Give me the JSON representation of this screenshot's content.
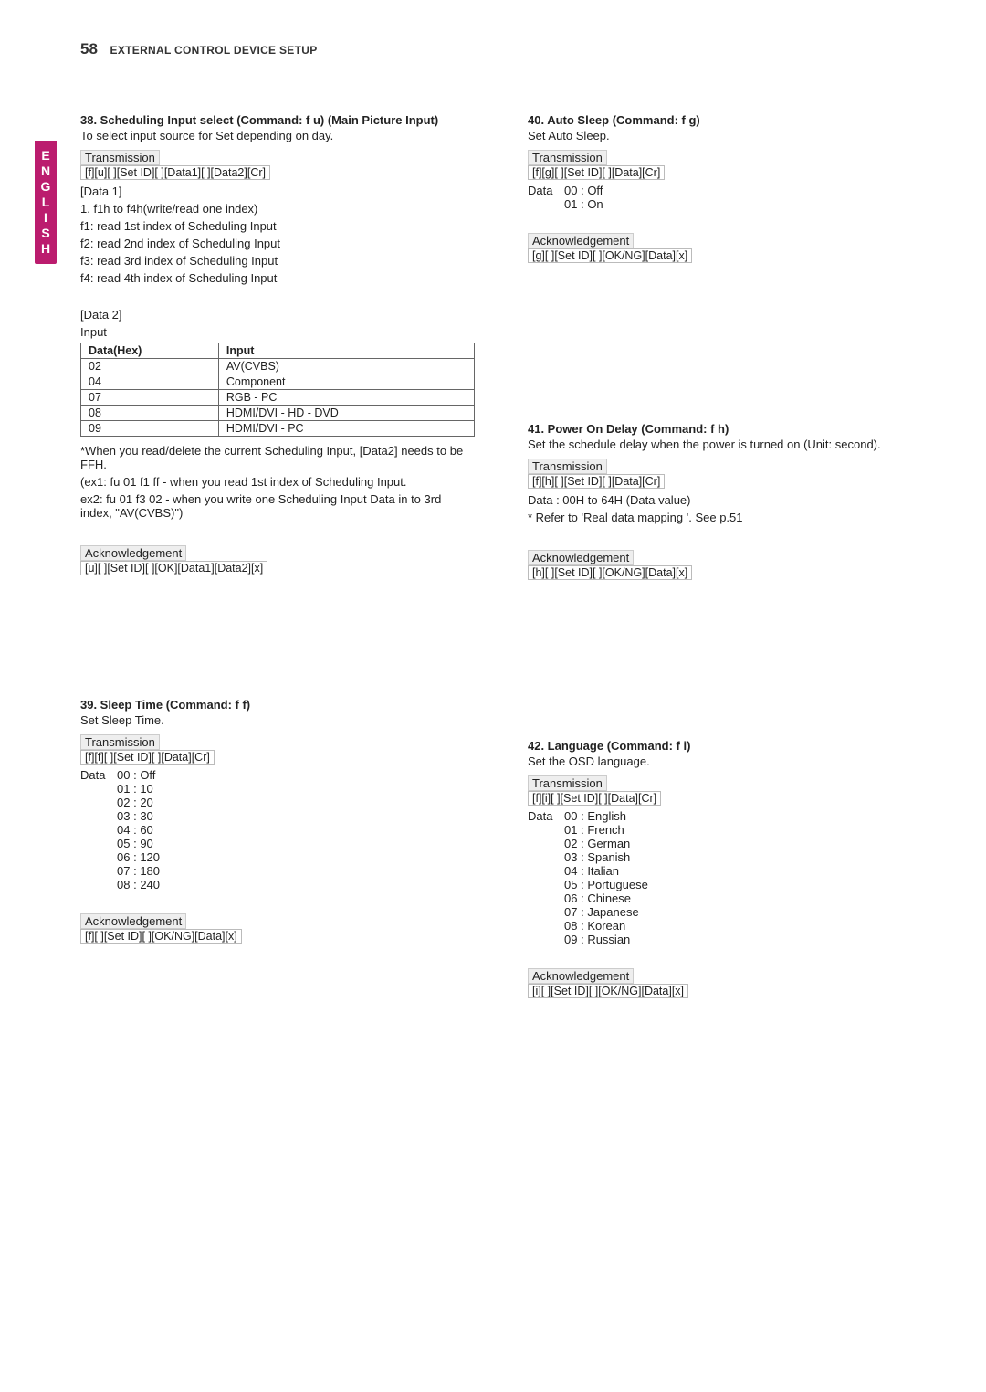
{
  "header": {
    "page_number": "58",
    "title": "EXTERNAL CONTROL DEVICE SETUP"
  },
  "side_tab": "ENGLISH",
  "labels": {
    "transmission": "Transmission",
    "acknowledgement": "Acknowledgement"
  },
  "cmd38": {
    "head": "38. Scheduling Input select (Command: f u) (Main Picture Input)",
    "desc": "To select input source for Set depending on day.",
    "tx_fmt": "[f][u][ ][Set ID][ ][Data1][ ][Data2][Cr]",
    "data1_label": "[Data 1]",
    "data1_lines": [
      "1.  f1h to f4h(write/read one index)",
      "f1: read 1st index of Scheduling Input",
      "f2: read 2nd index of Scheduling Input",
      "f3: read 3rd index of Scheduling Input",
      "f4: read 4th index of Scheduling Input"
    ],
    "data2_label": "[Data 2]",
    "data2_sub": "Input",
    "table_headers": [
      "Data(Hex)",
      "Input"
    ],
    "table_rows": [
      [
        "02",
        "AV(CVBS)"
      ],
      [
        "04",
        "Component"
      ],
      [
        "07",
        "RGB - PC"
      ],
      [
        "08",
        "HDMI/DVI - HD - DVD"
      ],
      [
        "09",
        "HDMI/DVI - PC"
      ]
    ],
    "notes": [
      "*When you read/delete the current Scheduling Input, [Data2] needs to be FFH.",
      "(ex1: fu 01 f1 ff - when you read 1st index of Scheduling Input.",
      "ex2: fu 01 f3 02 - when you write one Scheduling Input Data in to 3rd index, \"AV(CVBS)\")"
    ],
    "ack_fmt": "[u][ ][Set ID][ ][OK][Data1][Data2][x]"
  },
  "cmd39": {
    "head": "39. Sleep Time (Command: f f)",
    "desc": "Set Sleep Time.",
    "tx_fmt": "[f][f][ ][Set ID][ ][Data][Cr]",
    "data_label": "Data",
    "data_list": [
      [
        "00",
        "Off"
      ],
      [
        "01",
        "10"
      ],
      [
        "02",
        "20"
      ],
      [
        "03",
        "30"
      ],
      [
        "04",
        "60"
      ],
      [
        "05",
        "90"
      ],
      [
        "06",
        "120"
      ],
      [
        "07",
        "180"
      ],
      [
        "08",
        "240"
      ]
    ],
    "ack_fmt": "[f][ ][Set ID][ ][OK/NG][Data][x]"
  },
  "cmd40": {
    "head": "40. Auto Sleep (Command: f g)",
    "desc": "Set Auto Sleep.",
    "tx_fmt": "[f][g][ ][Set ID][ ][Data][Cr]",
    "data_label": "Data",
    "data_list": [
      [
        "00",
        "Off"
      ],
      [
        "01",
        "On"
      ]
    ],
    "ack_fmt": "[g][ ][Set ID][ ][OK/NG][Data][x]"
  },
  "cmd41": {
    "head": "41. Power On Delay (Command: f h)",
    "desc": "Set the schedule delay when the power is turned on (Unit: second).",
    "tx_fmt": "[f][h][ ][Set ID][ ][Data][Cr]",
    "data_lines": [
      "Data : 00H to 64H (Data value)",
      "* Refer to 'Real data mapping '. See p.51"
    ],
    "ack_fmt": "[h][ ][Set ID][ ][OK/NG][Data][x]"
  },
  "cmd42": {
    "head": "42. Language (Command: f i)",
    "desc": "Set the OSD language.",
    "tx_fmt": "[f][i][ ][Set ID][ ][Data][Cr]",
    "data_label": "Data",
    "data_list": [
      [
        "00",
        "English"
      ],
      [
        "01",
        "French"
      ],
      [
        "02",
        "German"
      ],
      [
        "03",
        "Spanish"
      ],
      [
        "04",
        "Italian"
      ],
      [
        "05",
        "Portuguese"
      ],
      [
        "06",
        "Chinese"
      ],
      [
        "07",
        "Japanese"
      ],
      [
        "08",
        "Korean"
      ],
      [
        "09",
        "Russian"
      ]
    ],
    "ack_fmt": "[i][ ][Set ID][ ][OK/NG][Data][x]"
  }
}
